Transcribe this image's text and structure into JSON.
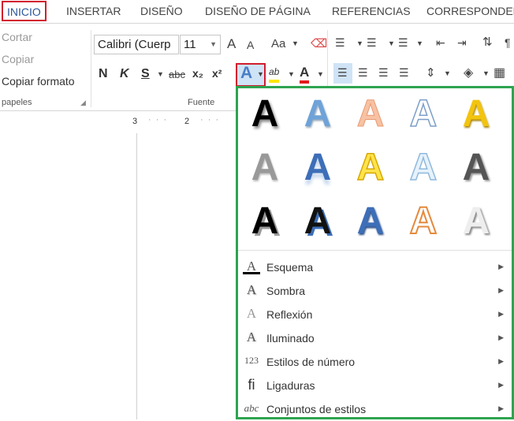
{
  "tabs": [
    "INICIO",
    "INSERTAR",
    "DISEÑO",
    "DISEÑO DE PÁGINA",
    "REFERENCIAS",
    "CORRESPONDEN"
  ],
  "clipboard": {
    "cut": "Cortar",
    "copy": "Copiar",
    "format_painter": "Copiar formato",
    "label": "papeles"
  },
  "font": {
    "name": "Calibri (Cuerp",
    "size": "11",
    "label": "Fuente",
    "bold": "N",
    "italic": "K",
    "underline": "S",
    "strike": "abc",
    "sub": "x₂",
    "sup": "x²",
    "grow": "A",
    "shrink": "A",
    "case": "Aa",
    "effects": "A",
    "highlight": "ab",
    "color": "A"
  },
  "ruler": {
    "t3": "3",
    "t2": "2"
  },
  "gallery": {
    "glyph": "A"
  },
  "menu": [
    {
      "icon": "A",
      "label": "Esquema"
    },
    {
      "icon": "A",
      "label": "Sombra"
    },
    {
      "icon": "A",
      "label": "Reflexión"
    },
    {
      "icon": "A",
      "label": "Iluminado"
    },
    {
      "icon": "123",
      "label": "Estilos de número"
    },
    {
      "icon": "fi",
      "label": "Ligaduras"
    },
    {
      "icon": "abc",
      "label": "Conjuntos de estilos"
    }
  ],
  "colors": {
    "accent": "#2b579a",
    "red_box": "#d11d2f",
    "green_box": "#2ea44f"
  }
}
